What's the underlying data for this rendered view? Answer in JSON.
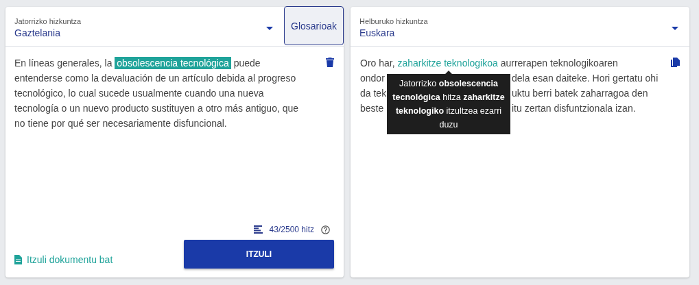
{
  "source": {
    "language_label": "Jatorrizko hizkuntza",
    "language": "Gaztelania",
    "glossary_button": "Glosarioak",
    "segments": [
      {
        "text": "En líneas generales, la ",
        "highlighted": false
      },
      {
        "text": "obsolescencia tecnológica",
        "highlighted": true
      },
      {
        "text": " puede entenderse como la devaluación de un artículo debida al progreso tecnológico, lo cual sucede usualmente cuando una nueva tecnología o un nuevo producto sustituyen a otro más antiguo, que no tiene por qué ser necesariamente disfuncional.",
        "highlighted": false
      }
    ],
    "word_count": "43/2500 hitz",
    "translate_button": "ITZULI",
    "document_link": "Itzuli dokumentu bat"
  },
  "target": {
    "language_label": "Helburuko hizkuntza",
    "language": "Euskara",
    "lines": [
      {
        "kind": "full",
        "segments": [
          {
            "text": "Oro har, ",
            "highlighted": false
          },
          {
            "text": "zaharkitze teknologikoa",
            "highlighted": true
          },
          {
            "text": " aurrerapen teknologikoaren",
            "highlighted": false
          }
        ]
      },
      {
        "kind": "split",
        "left": "ondor",
        "right": "dela esan daiteke. Hori gertatu ohi"
      },
      {
        "kind": "split",
        "left": "da tek",
        "right": "uktu berri batek zaharragoa den"
      },
      {
        "kind": "split",
        "left": "beste",
        "right": "itu zertan disfuntzionala izan."
      }
    ],
    "tooltip": "Jatorrizko **obsolescencia tecnológica** hitza **zaharkitze teknologiko** itzultzea ezarri duzu"
  }
}
